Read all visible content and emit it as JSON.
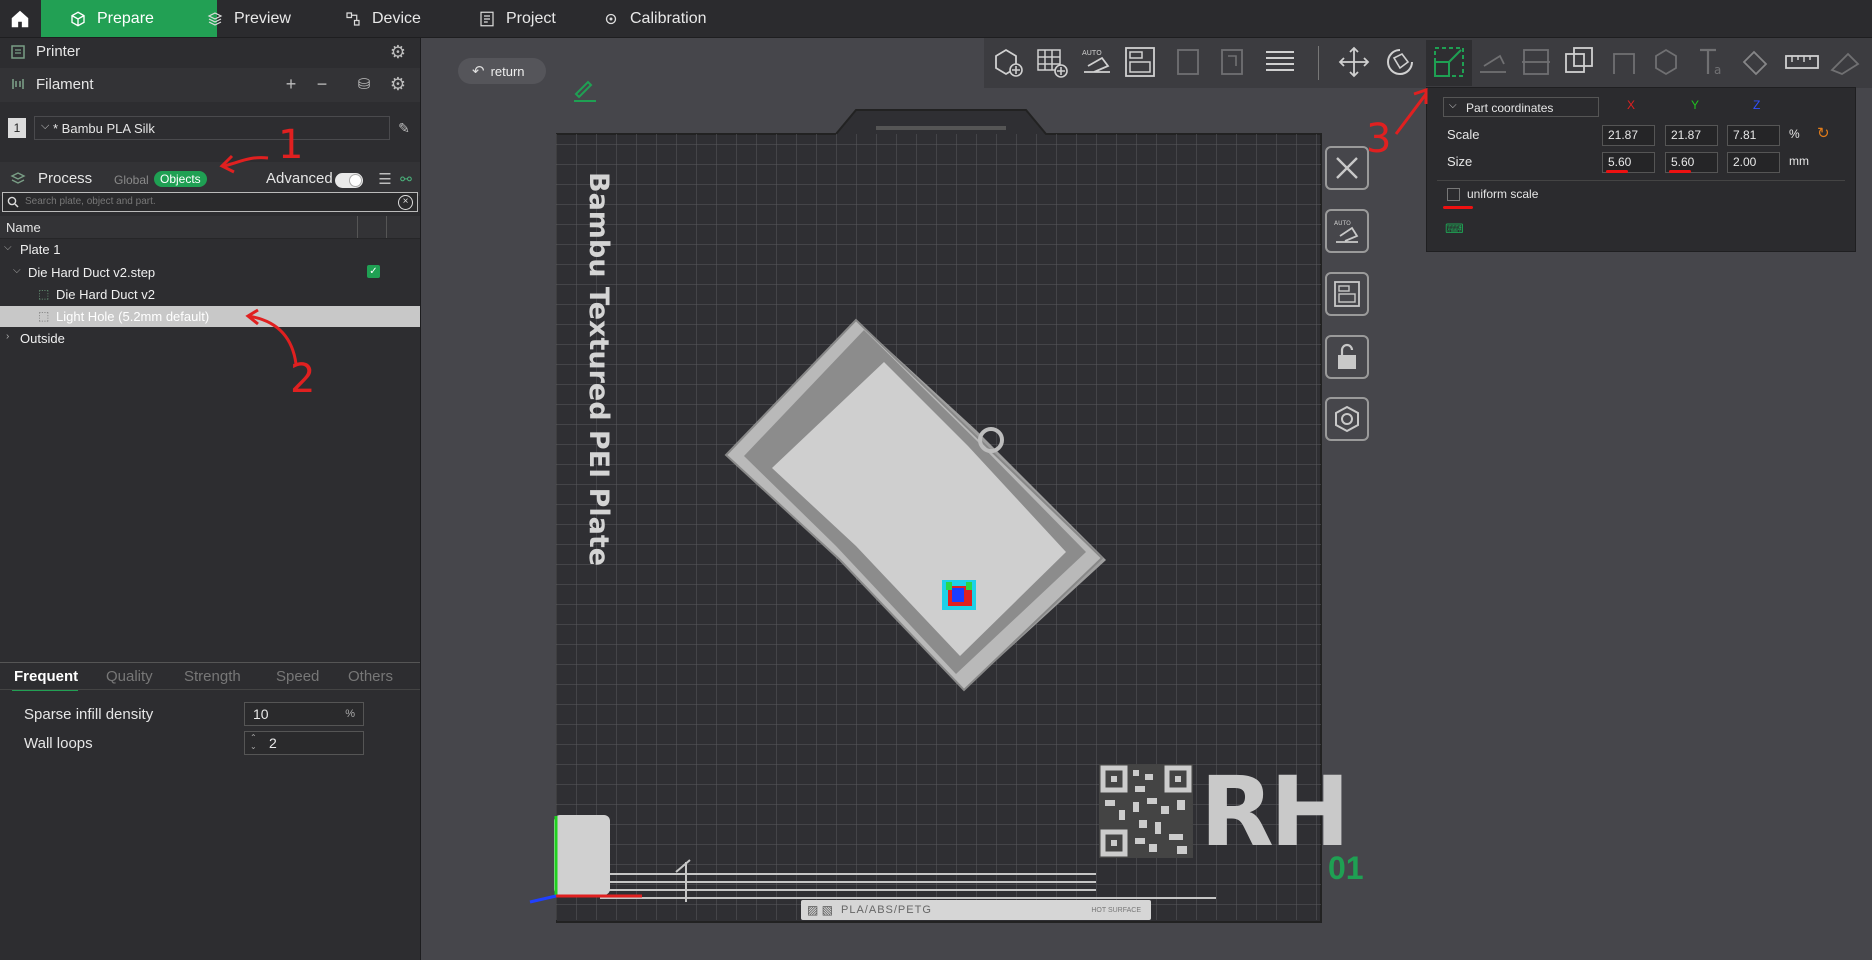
{
  "topbar": {
    "tabs": [
      {
        "label": "Prepare",
        "active": true
      },
      {
        "label": "Preview"
      },
      {
        "label": "Device"
      },
      {
        "label": "Project"
      },
      {
        "label": "Calibration"
      }
    ]
  },
  "sidebar": {
    "printer_label": "Printer",
    "filament_label": "Filament",
    "filament_index": "1",
    "filament_name": "* Bambu PLA Silk",
    "process_label": "Process",
    "global_label": "Global",
    "objects_label": "Objects",
    "advanced_label": "Advanced",
    "search_placeholder": "Search plate, object and part.",
    "tree_header": "Name",
    "tree": {
      "plate": "Plate 1",
      "object": "Die Hard Duct v2.step",
      "part1": "Die Hard Duct v2",
      "part2": "Light Hole (5.2mm default)",
      "outside": "Outside"
    },
    "settings_tabs": [
      "Frequent",
      "Quality",
      "Strength",
      "Speed",
      "Others"
    ],
    "settings": {
      "infill_label": "Sparse infill density",
      "infill_value": "10",
      "infill_unit": "%",
      "walls_label": "Wall loops",
      "walls_value": "2"
    }
  },
  "canvas": {
    "return_label": "return",
    "plate_label": "Bambu Textured PEI Plate",
    "plate_number": "01",
    "plate_footer": "PLA/ABS/PETG",
    "plate_footer2": "HOT SURFACE",
    "logo_text": "RH"
  },
  "part_panel": {
    "coord_select": "Part coordinates",
    "axis_x": "X",
    "axis_y": "Y",
    "axis_z": "Z",
    "scale_label": "Scale",
    "scale_x": "21.87",
    "scale_y": "21.87",
    "scale_z": "7.81",
    "scale_unit": "%",
    "size_label": "Size",
    "size_x": "5.60",
    "size_y": "5.60",
    "size_z": "2.00",
    "size_unit": "mm",
    "uniform_label": "uniform scale"
  },
  "annotations": {
    "a1": "1",
    "a2": "2",
    "a3": "3"
  },
  "colors": {
    "accent": "#22a054",
    "annotation": "#e02020"
  }
}
